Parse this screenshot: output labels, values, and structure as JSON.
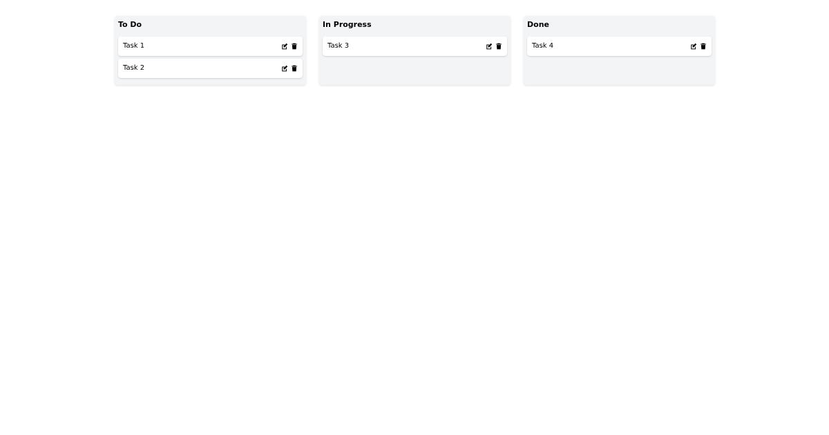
{
  "board": {
    "columns": [
      {
        "title": "To Do",
        "tasks": [
          {
            "label": "Task 1",
            "edit_icon": "edit-icon",
            "delete_icon": "trash-icon"
          },
          {
            "label": "Task 2",
            "edit_icon": "edit-icon",
            "delete_icon": "trash-icon"
          }
        ]
      },
      {
        "title": "In Progress",
        "tasks": [
          {
            "label": "Task 3",
            "edit_icon": "edit-icon",
            "delete_icon": "trash-icon"
          }
        ]
      },
      {
        "title": "Done",
        "tasks": [
          {
            "label": "Task 4",
            "edit_icon": "edit-icon",
            "delete_icon": "trash-icon"
          }
        ]
      }
    ]
  },
  "colors": {
    "page_background": "#ffffff",
    "column_background": "#f3f4f6",
    "card_background": "#ffffff",
    "text": "#000000"
  }
}
